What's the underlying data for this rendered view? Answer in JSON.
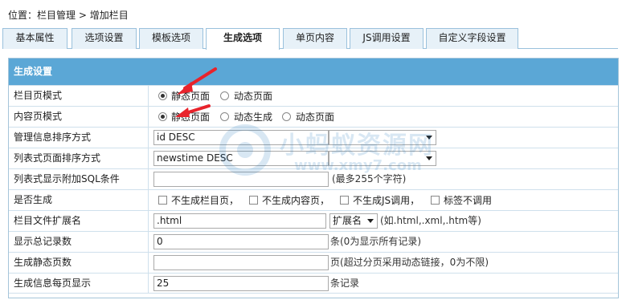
{
  "breadcrumb": {
    "prefix": "位置：",
    "section": "栏目管理",
    "separator": " > ",
    "current": "增加栏目"
  },
  "tabs": [
    {
      "label": "基本属性"
    },
    {
      "label": "选项设置"
    },
    {
      "label": "模板选项"
    },
    {
      "label": "生成选项"
    },
    {
      "label": "单页内容"
    },
    {
      "label": "JS调用设置"
    },
    {
      "label": "自定义字段设置"
    }
  ],
  "panel": {
    "title": "生成设置"
  },
  "rows": {
    "list_mode": {
      "label": "栏目页模式",
      "options": [
        "静态页面",
        "动态页面"
      ],
      "selected": "静态页面"
    },
    "content_mode": {
      "label": "内容页模式",
      "options": [
        "静态页面",
        "动态生成",
        "动态页面"
      ],
      "selected": "静态页面"
    },
    "manage_order": {
      "label": "管理信息排序方式",
      "value": "id DESC"
    },
    "list_order": {
      "label": "列表式页面排序方式",
      "value": "newstime DESC"
    },
    "list_sql": {
      "label": "列表式显示附加SQL条件",
      "value": "",
      "hint": "(最多255个字符)"
    },
    "generate": {
      "label": "是否生成",
      "options": [
        "不生成栏目页，",
        "不生成内容页，",
        "不生成JS调用，",
        "标签不调用"
      ]
    },
    "file_ext": {
      "label": "栏目文件扩展名",
      "value": ".html",
      "select": "扩展名",
      "hint": "(如.html,.xml,.htm等)"
    },
    "total_records": {
      "label": "显示总记录数",
      "value": "0",
      "hint": "条(0为显示所有记录)"
    },
    "static_pages": {
      "label": "生成静态页数",
      "value": "",
      "hint": "页(超过分页采用动态链接，0为不限)"
    },
    "per_page": {
      "label": "生成信息每页显示",
      "value": "25",
      "hint": "条记录"
    }
  },
  "watermark": {
    "text": "小蚂蚁资源网",
    "url": "www.xmy7.com"
  },
  "colors": {
    "header_bg": "#5ba7d6",
    "tab_bg": "#e7f1f8",
    "border": "#9ac1dc",
    "arrow": "#e8232b"
  }
}
